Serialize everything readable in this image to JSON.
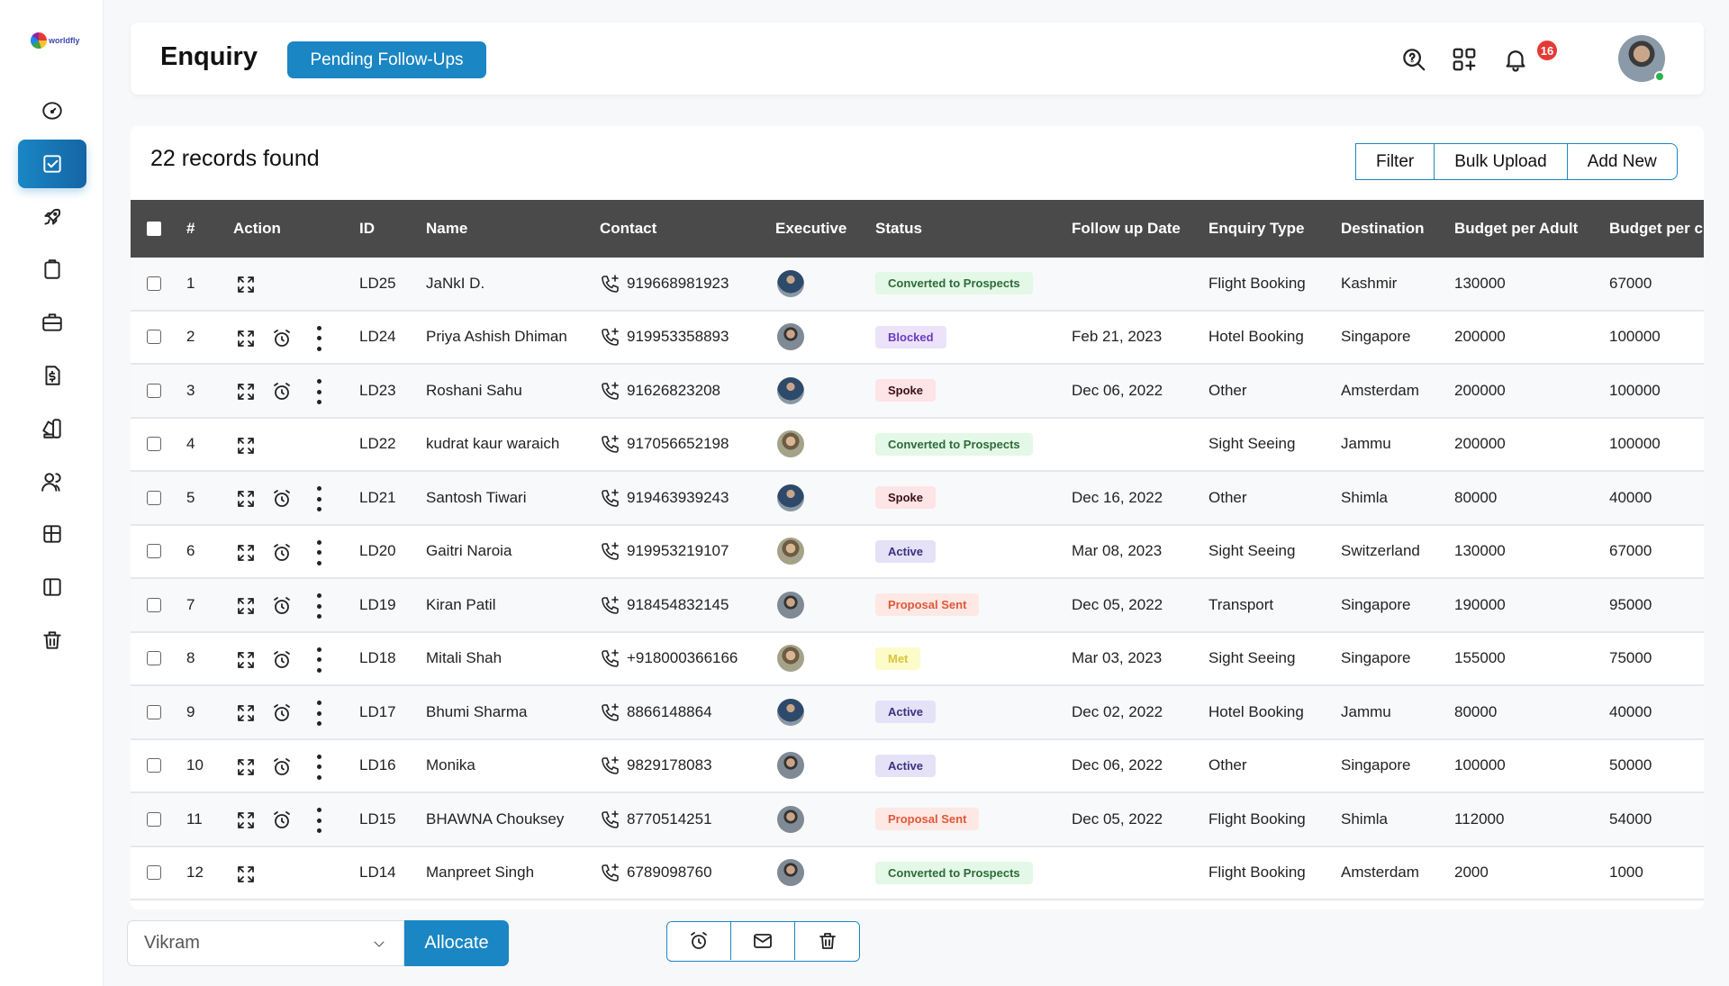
{
  "app": {
    "logo_text": "worldfly"
  },
  "sidebar": {
    "items": [
      {
        "icon": "dashboard-gauge-icon",
        "active": false
      },
      {
        "icon": "enquiry-checkbox-icon",
        "active": true
      },
      {
        "icon": "rocket-icon",
        "active": false
      },
      {
        "icon": "clipboard-icon",
        "active": false
      },
      {
        "icon": "briefcase-icon",
        "active": false
      },
      {
        "icon": "invoice-dollar-icon",
        "active": false
      },
      {
        "icon": "swatches-icon",
        "active": false
      },
      {
        "icon": "users-icon",
        "active": false
      },
      {
        "icon": "table-grid-icon",
        "active": false
      },
      {
        "icon": "sidebar-layout-icon",
        "active": false
      },
      {
        "icon": "trash-icon",
        "active": false
      }
    ]
  },
  "header": {
    "title": "Enquiry",
    "pending_button": "Pending Follow-Ups",
    "notification_count": "16"
  },
  "records": {
    "count_label": "22 records found",
    "buttons": {
      "filter": "Filter",
      "bulk_upload": "Bulk Upload",
      "add_new": "Add New"
    }
  },
  "table": {
    "columns": [
      "#",
      "Action",
      "ID",
      "Name",
      "Contact",
      "Executive",
      "Status",
      "Follow up Date",
      "Enquiry Type",
      "Destination",
      "Budget per Adult",
      "Budget per c"
    ],
    "rows": [
      {
        "num": "1",
        "id": "LD25",
        "name": "JaNkI D.",
        "contact": "919668981923",
        "status": "Converted to Prospects",
        "followup": "",
        "type": "Flight Booking",
        "destination": "Kashmir",
        "budget_adult": "130000",
        "budget_child": "67000",
        "full_actions": false,
        "exec": "a"
      },
      {
        "num": "2",
        "id": "LD24",
        "name": "Priya Ashish Dhiman",
        "contact": "919953358893",
        "status": "Blocked",
        "followup": "Feb 21, 2023",
        "type": "Hotel Booking",
        "destination": "Singapore",
        "budget_adult": "200000",
        "budget_child": "100000",
        "full_actions": true,
        "exec": "b"
      },
      {
        "num": "3",
        "id": "LD23",
        "name": "Roshani Sahu",
        "contact": "91626823208",
        "status": "Spoke",
        "followup": "Dec 06, 2022",
        "type": "Other",
        "destination": "Amsterdam",
        "budget_adult": "200000",
        "budget_child": "100000",
        "full_actions": true,
        "exec": "a"
      },
      {
        "num": "4",
        "id": "LD22",
        "name": "kudrat kaur waraich",
        "contact": "917056652198",
        "status": "Converted to Prospects",
        "followup": "",
        "type": "Sight Seeing",
        "destination": "Jammu",
        "budget_adult": "200000",
        "budget_child": "100000",
        "full_actions": false,
        "exec": "c"
      },
      {
        "num": "5",
        "id": "LD21",
        "name": "Santosh Tiwari",
        "contact": "919463939243",
        "status": "Spoke",
        "followup": "Dec 16, 2022",
        "type": "Other",
        "destination": "Shimla",
        "budget_adult": "80000",
        "budget_child": "40000",
        "full_actions": true,
        "exec": "a"
      },
      {
        "num": "6",
        "id": "LD20",
        "name": "Gaitri Naroia",
        "contact": "919953219107",
        "status": "Active",
        "followup": "Mar 08, 2023",
        "type": "Sight Seeing",
        "destination": "Switzerland",
        "budget_adult": "130000",
        "budget_child": "67000",
        "full_actions": true,
        "exec": "c"
      },
      {
        "num": "7",
        "id": "LD19",
        "name": "Kiran Patil",
        "contact": "918454832145",
        "status": "Proposal Sent",
        "followup": "Dec 05, 2022",
        "type": "Transport",
        "destination": "Singapore",
        "budget_adult": "190000",
        "budget_child": "95000",
        "full_actions": true,
        "exec": "b"
      },
      {
        "num": "8",
        "id": "LD18",
        "name": "Mitali Shah",
        "contact": "+918000366166",
        "status": "Met",
        "followup": "Mar 03, 2023",
        "type": "Sight Seeing",
        "destination": "Singapore",
        "budget_adult": "155000",
        "budget_child": "75000",
        "full_actions": true,
        "exec": "c"
      },
      {
        "num": "9",
        "id": "LD17",
        "name": "Bhumi Sharma",
        "contact": "8866148864",
        "status": "Active",
        "followup": "Dec 02, 2022",
        "type": "Hotel Booking",
        "destination": "Jammu",
        "budget_adult": "80000",
        "budget_child": "40000",
        "full_actions": true,
        "exec": "a"
      },
      {
        "num": "10",
        "id": "LD16",
        "name": "Monika",
        "contact": "9829178083",
        "status": "Active",
        "followup": "Dec 06, 2022",
        "type": "Other",
        "destination": "Singapore",
        "budget_adult": "100000",
        "budget_child": "50000",
        "full_actions": true,
        "exec": "b"
      },
      {
        "num": "11",
        "id": "LD15",
        "name": "BHAWNA Chouksey",
        "contact": "8770514251",
        "status": "Proposal Sent",
        "followup": "Dec 05, 2022",
        "type": "Flight Booking",
        "destination": "Shimla",
        "budget_adult": "112000",
        "budget_child": "54000",
        "full_actions": true,
        "exec": "b"
      },
      {
        "num": "12",
        "id": "LD14",
        "name": "Manpreet Singh",
        "contact": "6789098760",
        "status": "Converted to Prospects",
        "followup": "",
        "type": "Flight Booking",
        "destination": "Amsterdam",
        "budget_adult": "2000",
        "budget_child": "1000",
        "full_actions": false,
        "exec": "b"
      }
    ]
  },
  "status_colors": {
    "Converted to Prospects": {
      "bg": "#e3f8e6",
      "fg": "#2e6b3a"
    },
    "Blocked": {
      "bg": "#ece3fb",
      "fg": "#6a3bbf"
    },
    "Spoke": {
      "bg": "#fde4e6",
      "fg": "#3b1018"
    },
    "Active": {
      "bg": "#e5e2f7",
      "fg": "#3a3280"
    },
    "Proposal Sent": {
      "bg": "#fde8e4",
      "fg": "#e0583a"
    },
    "Met": {
      "bg": "#fdfbc9",
      "fg": "#d9c53a"
    }
  },
  "footer": {
    "executive_select_value": "Vikram",
    "allocate_label": "Allocate"
  },
  "colors": {
    "accent": "#1a86c4",
    "table_header": "#4a4a4a",
    "notification": "#e53935",
    "online": "#2bb24c"
  }
}
